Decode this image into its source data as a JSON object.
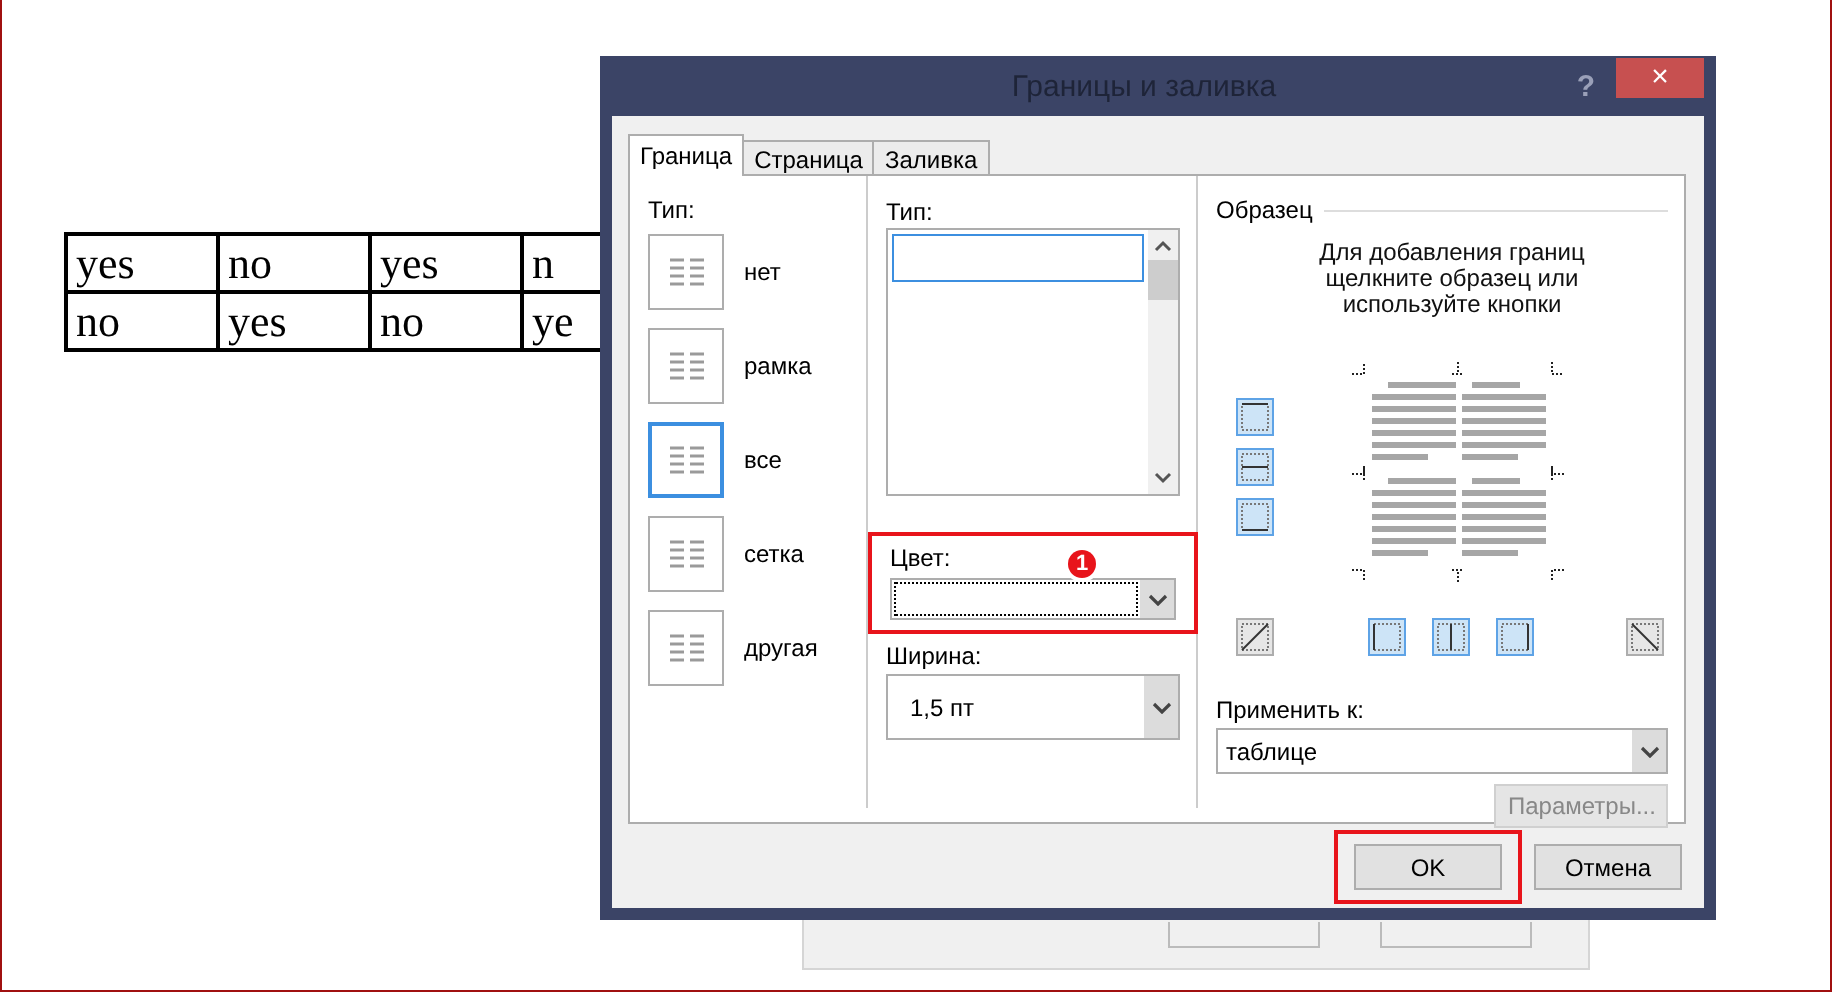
{
  "document_table": {
    "rows": [
      [
        "yes",
        "no",
        "yes",
        "n"
      ],
      [
        "no",
        "yes",
        "no",
        "ye"
      ]
    ]
  },
  "dialog": {
    "title": "Границы и заливка",
    "help": "?",
    "close": "×"
  },
  "tabs": [
    {
      "label": "Граница",
      "selected": true
    },
    {
      "label": "Страница",
      "selected": false
    },
    {
      "label": "Заливка",
      "selected": false
    }
  ],
  "setting": {
    "label": "Тип:",
    "options": [
      {
        "label": "нет",
        "selected": false
      },
      {
        "label": "рамка",
        "selected": false
      },
      {
        "label": "все",
        "selected": true
      },
      {
        "label": "сетка",
        "selected": false
      },
      {
        "label": "другая",
        "selected": false
      }
    ]
  },
  "style": {
    "label": "Тип:",
    "items": [
      {
        "selected": true
      }
    ]
  },
  "color": {
    "label": "Цвет:",
    "highlighted": true,
    "callout": "1"
  },
  "width": {
    "label": "Ширина:",
    "value": "1,5 пт"
  },
  "preview": {
    "label": "Образец",
    "hint": "Для добавления границ\nщелкните образец или\nиспользуйте кнопки",
    "side_buttons": [
      {
        "kind": "top",
        "on": true
      },
      {
        "kind": "middle-h",
        "on": true
      },
      {
        "kind": "bottom",
        "on": true
      }
    ],
    "bottom_buttons": [
      {
        "kind": "diag-up",
        "on": false
      },
      {
        "kind": "left",
        "on": true
      },
      {
        "kind": "middle-v",
        "on": true
      },
      {
        "kind": "right",
        "on": true
      },
      {
        "kind": "diag-down",
        "on": false
      }
    ]
  },
  "apply_to": {
    "label": "Применить к:",
    "value": "таблице"
  },
  "options_button": {
    "label": "Параметры...",
    "disabled": true
  },
  "buttons": [
    {
      "label": "OK",
      "highlighted": true
    },
    {
      "label": "Отмена",
      "highlighted": false
    }
  ]
}
